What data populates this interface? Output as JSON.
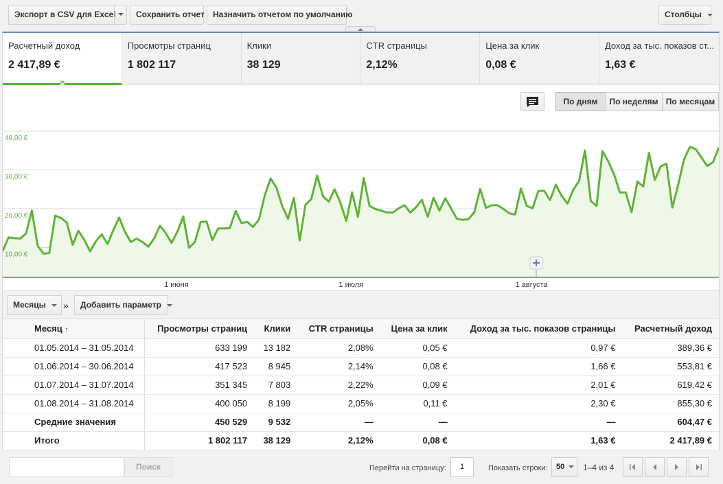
{
  "toolbar": {
    "export_label": "Экспорт в CSV для Excel",
    "save_label": "Сохранить отчет",
    "default_label": "Назначить отчетом по умолчанию",
    "columns_label": "Столбцы"
  },
  "metrics": [
    {
      "name": "Расчетный доход",
      "value": "2 417,89 €"
    },
    {
      "name": "Просмотры страниц",
      "value": "1 802 117"
    },
    {
      "name": "Клики",
      "value": "38 129"
    },
    {
      "name": "CTR страницы",
      "value": "2,12%"
    },
    {
      "name": "Цена за клик",
      "value": "0,08 €"
    },
    {
      "name": "Доход за тыс. показов ст...",
      "value": "1,63 €"
    }
  ],
  "period": {
    "days": "По дням",
    "weeks": "По неделям",
    "months": "По месяцам"
  },
  "chart_data": {
    "type": "area",
    "series": [
      {
        "color": "#5fb336",
        "values": [
          9.1,
          12.6,
          12.4,
          12.3,
          13.6,
          19.5,
          10.4,
          8.4,
          8.6,
          18.2,
          17.6,
          16.4,
          10.7,
          14.3,
          12.0,
          9.0,
          11.6,
          13.4,
          10.9,
          14.5,
          17.7,
          14.0,
          11.4,
          12.3,
          11.4,
          10.2,
          12.3,
          15.6,
          13.7,
          11.2,
          14.1,
          18.0,
          9.9,
          11.4,
          16.6,
          16.7,
          11.9,
          14.9,
          14.9,
          15.0,
          19.4,
          16.3,
          16.6,
          15.3,
          17.2,
          23.4,
          27.8,
          25.5,
          20.7,
          17.4,
          22.8,
          11.8,
          21.0,
          22.5,
          28.5,
          23.2,
          21.8,
          25.0,
          21.5,
          16.8,
          24.2,
          17.9,
          27.9,
          20.7,
          19.9,
          19.5,
          19.0,
          19.0,
          20.1,
          20.9,
          19.0,
          20.4,
          22.3,
          17.9,
          22.8,
          19.5,
          22.7,
          20.1,
          17.4,
          17.1,
          17.3,
          19.1,
          25.1,
          20.2,
          20.9,
          20.9,
          19.9,
          18.8,
          18.5,
          25.2,
          20.7,
          20.1,
          24.6,
          24.6,
          22.2,
          26.2,
          23.3,
          21.3,
          24.9,
          27.2,
          35.0,
          22.0,
          20.7,
          34.8,
          32.2,
          28.8,
          24.2,
          24.2,
          19.1,
          27.0,
          25.7,
          34.4,
          27.4,
          30.9,
          31.6,
          20.3,
          26.1,
          32.6,
          35.9,
          35.4,
          33.2,
          31.0,
          32.0,
          35.8
        ]
      }
    ],
    "x_ticks": [
      "1 июня",
      "1 июля",
      "1 августа"
    ],
    "y_ticks": [
      "10,00 €",
      "20,00 €",
      "30,00 €",
      "40,00 €"
    ],
    "ylim": [
      0,
      42
    ],
    "grid": true
  },
  "dimension": {
    "months_label": "Месяцы",
    "arrow": "»",
    "add_param": "Добавить параметр"
  },
  "table": {
    "headers": [
      "Месяц",
      "Просмотры страниц",
      "Клики",
      "CTR страницы",
      "Цена за клик",
      "Доход за тыс. показов страницы",
      "Расчетный доход"
    ],
    "sort_arrow": "↑",
    "rows": [
      [
        "01.05.2014 – 31.05.2014",
        "633 199",
        "13 182",
        "2,08%",
        "0,05 €",
        "0,97 €",
        "389,36 €"
      ],
      [
        "01.06.2014 – 30.06.2014",
        "417 523",
        "8 945",
        "2,14%",
        "0,08 €",
        "1,66 €",
        "553,81 €"
      ],
      [
        "01.07.2014 – 31.07.2014",
        "351 345",
        "7 803",
        "2,22%",
        "0,09 €",
        "2,01 €",
        "619,42 €"
      ],
      [
        "01.08.2014 – 31.08.2014",
        "400 050",
        "8 199",
        "2,05%",
        "0,11 €",
        "2,30 €",
        "855,30 €"
      ]
    ],
    "avg": [
      "Средние значения",
      "450 529",
      "9 532",
      "—",
      "—",
      "—",
      "604,47 €"
    ],
    "total": [
      "Итого",
      "1 802 117",
      "38 129",
      "2,12%",
      "0,08 €",
      "1,63 €",
      "2 417,89 €"
    ]
  },
  "footer": {
    "search_placeholder": "",
    "search_label": "Поиск",
    "goto_label": "Перейти на страницу:",
    "page_value": "1",
    "rows_label": "Показать строки:",
    "rows_value": "50",
    "range": "1–4 из 4"
  }
}
